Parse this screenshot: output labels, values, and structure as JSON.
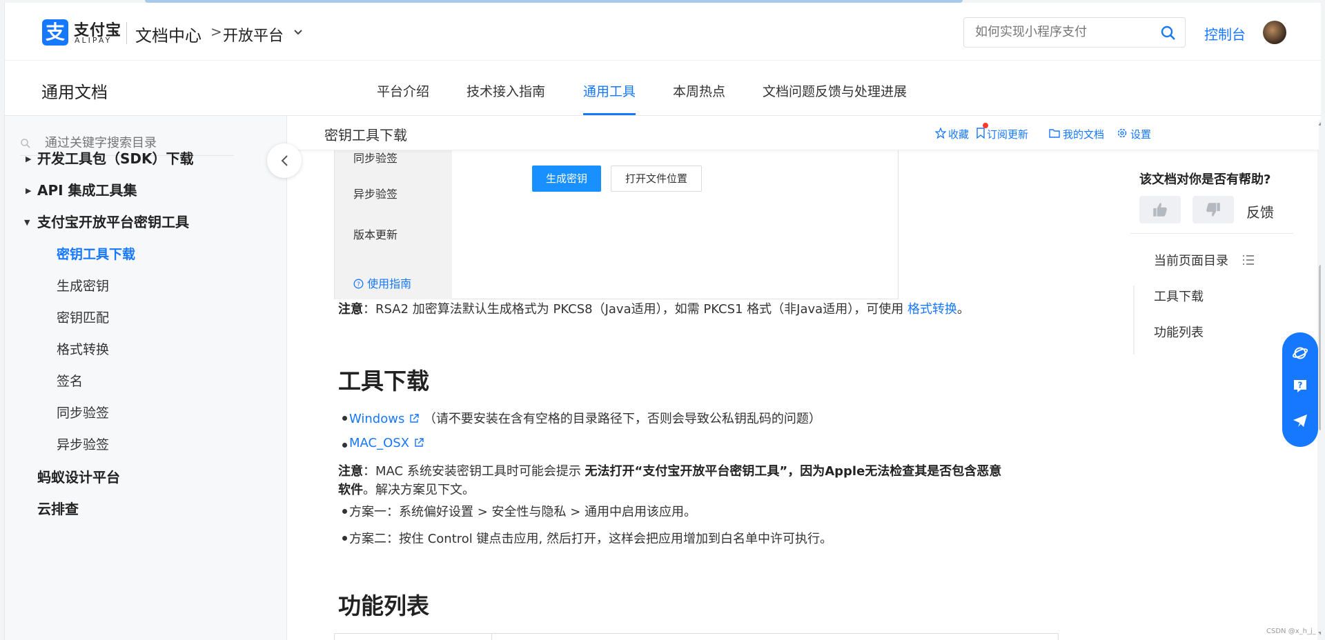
{
  "header": {
    "logo_char": "支",
    "logo_text": "支付宝",
    "logo_sub": "ALIPAY",
    "doc_center": "文档中心",
    "breadcrumb_sep": ">",
    "open_platform": "开放平台",
    "search_placeholder": "如何实现小程序支付",
    "console": "控制台"
  },
  "nav": {
    "title": "通用文档",
    "tabs": [
      "平台介绍",
      "技术接入指南",
      "通用工具",
      "本周热点",
      "文档问题反馈与处理进展"
    ],
    "active_tab": "通用工具"
  },
  "sidebar": {
    "search_placeholder": "通过关键字搜索目录",
    "items": [
      {
        "label": "开发工具包（SDK）下载"
      },
      {
        "label": "API 集成工具集"
      },
      {
        "label": "支付宝开放平台密钥工具"
      },
      {
        "label": "密钥工具下载"
      },
      {
        "label": "生成密钥"
      },
      {
        "label": "密钥匹配"
      },
      {
        "label": "格式转换"
      },
      {
        "label": "签名"
      },
      {
        "label": "同步验签"
      },
      {
        "label": "异步验签"
      },
      {
        "label": "蚂蚁设计平台"
      },
      {
        "label": "云排查"
      }
    ]
  },
  "docbar": {
    "title": "密钥工具下载",
    "actions": [
      "收藏",
      "订阅更新",
      "我的文档",
      "设置"
    ]
  },
  "screenshot": {
    "menu": [
      "同步验签",
      "异步验签",
      "版本更新"
    ],
    "guide": "使用指南",
    "btn_generate": "生成密钥",
    "btn_open": "打开文件位置"
  },
  "content": {
    "note1_label": "注意",
    "note1_text": "：RSA2 加密算法默认生成格式为 PKCS8（Java适用），如需 PKCS1 格式（非Java适用），可使用 ",
    "note1_link": "格式转换",
    "note1_end": "。",
    "h_download": "工具下载",
    "win_link": "Windows",
    "win_note": "（请不要安装在含有空格的目录路径下，否则会导致公私钥乱码的问题）",
    "mac_link": "MAC_OSX",
    "note2_label": "注意",
    "note2_text": "：MAC 系统安装密钥工具时可能会提示 ",
    "note2_bold": "无法打开“支付宝开放平台密钥工具”，因为Apple无法检查其是否包含恶意",
    "note2_bold2": "软件",
    "note2_end": "。解决方案见下文。",
    "plan1": "方案一：系统偏好设置 > 安全性与隐私 > 通用中启用该应用。",
    "plan2": "方案二：按住 Control 键点击应用, 然后打开，这样会把应用增加到白名单中许可执行。",
    "h_features": "功能列表"
  },
  "right": {
    "help_title": "该文档对你是否有帮助?",
    "feedback": "反馈",
    "toc_title": "当前页面目录",
    "toc": [
      "工具下载",
      "功能列表"
    ]
  },
  "watermark": "CSDN @x_h_j_"
}
